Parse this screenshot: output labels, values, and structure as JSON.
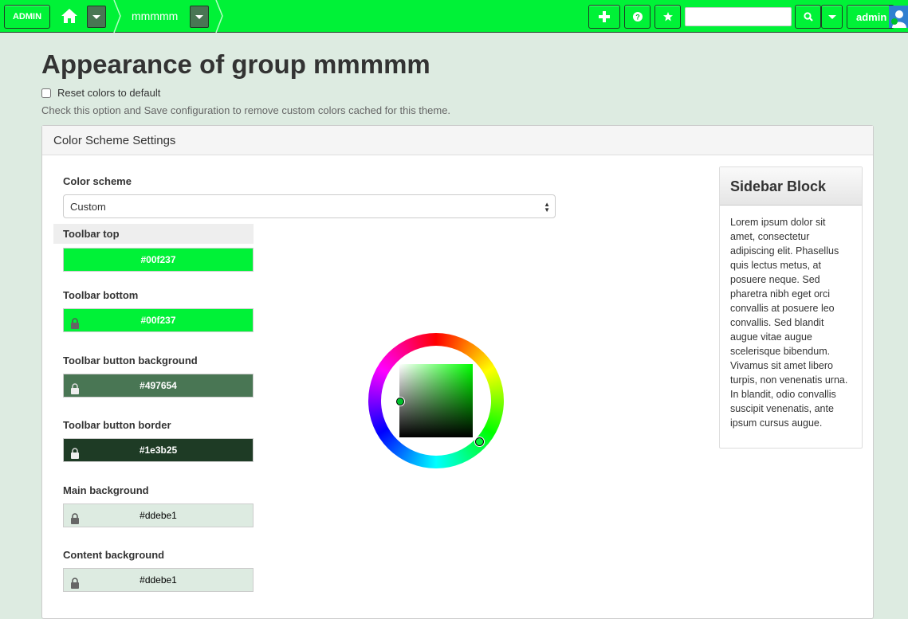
{
  "toolbar": {
    "admin_label": "ADMIN",
    "breadcrumb_group": "mmmmm",
    "search_placeholder": "",
    "user_label": "admin",
    "icons": [
      "home-icon",
      "plus-icon",
      "help-icon",
      "star-icon",
      "search-icon",
      "user-avatar-icon"
    ]
  },
  "page": {
    "title": "Appearance of group mmmmm",
    "reset_label": "Reset colors to default",
    "reset_help": "Check this option and Save configuration to remove custom colors cached for this theme."
  },
  "panel": {
    "title": "Color Scheme Settings",
    "scheme_label": "Color scheme",
    "scheme_value": "Custom",
    "colors": [
      {
        "label": "Toolbar top",
        "value": "#00f237",
        "color": "#00f237",
        "text_color": "#ffffff",
        "locked": false
      },
      {
        "label": "Toolbar bottom",
        "value": "#00f237",
        "color": "#00f237",
        "text_color": "#ffffff",
        "locked": true
      },
      {
        "label": "Toolbar button background",
        "value": "#497654",
        "color": "#497654",
        "text_color": "#ffffff",
        "locked": true
      },
      {
        "label": "Toolbar button border",
        "value": "#1e3b25",
        "color": "#1e3b25",
        "text_color": "#ffffff",
        "locked": true
      },
      {
        "label": "Main background",
        "value": "#ddebe1",
        "color": "#ddebe1",
        "text_color": "#000000",
        "locked": true
      },
      {
        "label": "Content background",
        "value": "#ddebe1",
        "color": "#ddebe1",
        "text_color": "#000000",
        "locked": true
      }
    ]
  },
  "sidebar": {
    "title": "Sidebar Block",
    "body": "Lorem ipsum dolor sit amet, consectetur adipiscing elit. Phasellus quis lectus metus, at posuere neque. Sed pharetra nibh eget orci convallis at posuere leo convallis. Sed blandit augue vitae augue scelerisque bibendum. Vivamus sit amet libero turpis, non venenatis urna. In blandit, odio convallis suscipit venenatis, ante ipsum cursus augue."
  }
}
